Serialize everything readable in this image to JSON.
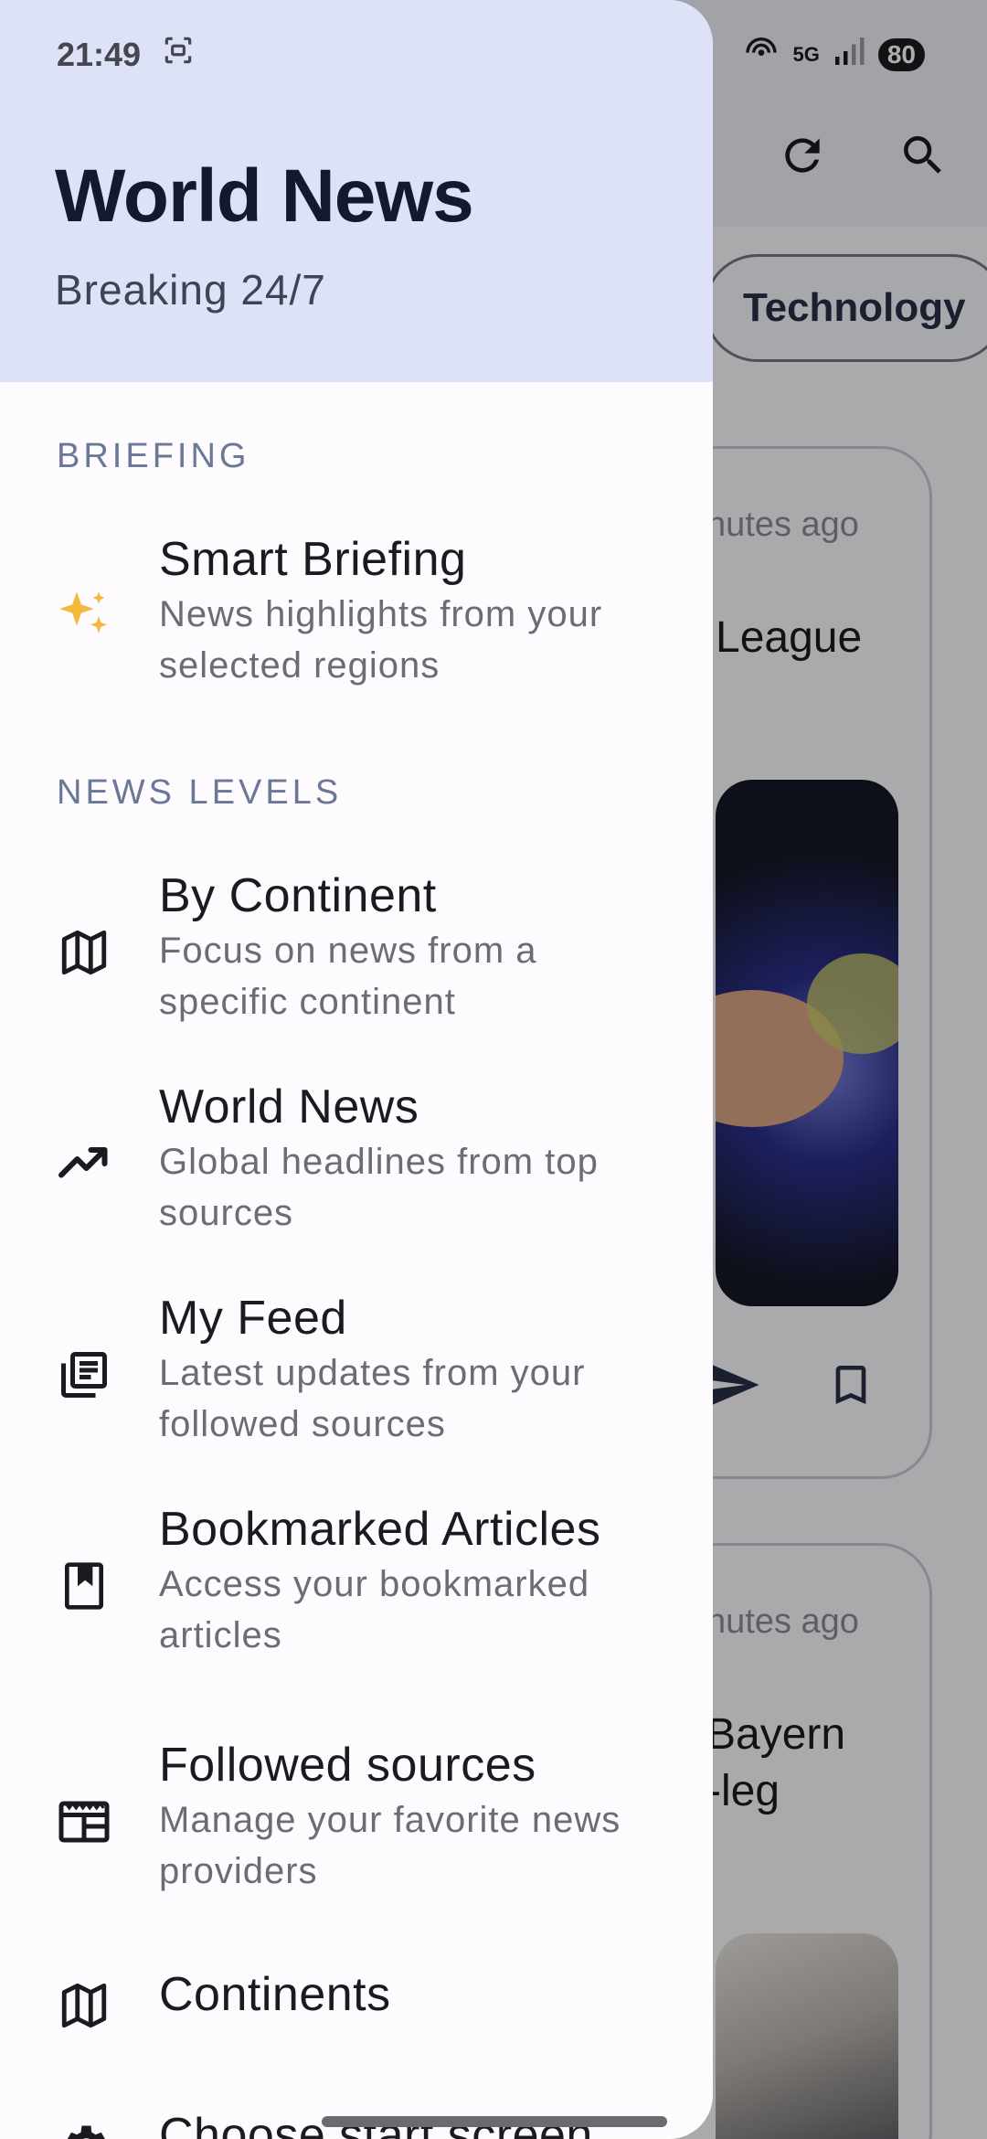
{
  "status": {
    "time": "21:49",
    "network": "5G",
    "battery": "80"
  },
  "drawer": {
    "title": "World News",
    "subtitle": "Breaking 24/7",
    "sections": {
      "briefing": "BRIEFING",
      "levels": "NEWS LEVELS"
    },
    "items": [
      {
        "title": "Smart Briefing",
        "desc": "News highlights from your selected regions",
        "icon": "sparkles-icon"
      },
      {
        "title": "By Continent",
        "desc": "Focus on news from a specific continent",
        "icon": "map-icon"
      },
      {
        "title": "World News",
        "desc": "Global headlines from top sources",
        "icon": "trending-up-icon"
      },
      {
        "title": "My Feed",
        "desc": "Latest updates from your followed sources",
        "icon": "feed-icon"
      },
      {
        "title": "Bookmarked Articles",
        "desc": "Access your bookmarked articles",
        "icon": "bookmark-book-icon"
      },
      {
        "title": "Followed sources",
        "desc": "Manage your favorite news providers",
        "icon": "newspaper-icon"
      },
      {
        "title": "Continents",
        "desc": "",
        "icon": "map-icon"
      },
      {
        "title": "Choose start screen",
        "desc": "",
        "icon": "settings-gear-icon"
      }
    ]
  },
  "background": {
    "chip": "Technology",
    "cards": [
      {
        "time": "nutes ago",
        "title": "League"
      },
      {
        "time": "nutes ago",
        "title_line1": "Bayern",
        "title_line2": "-leg"
      }
    ]
  },
  "colors": {
    "accent": "#dee2f6",
    "sparkle": "#f4b93a"
  }
}
